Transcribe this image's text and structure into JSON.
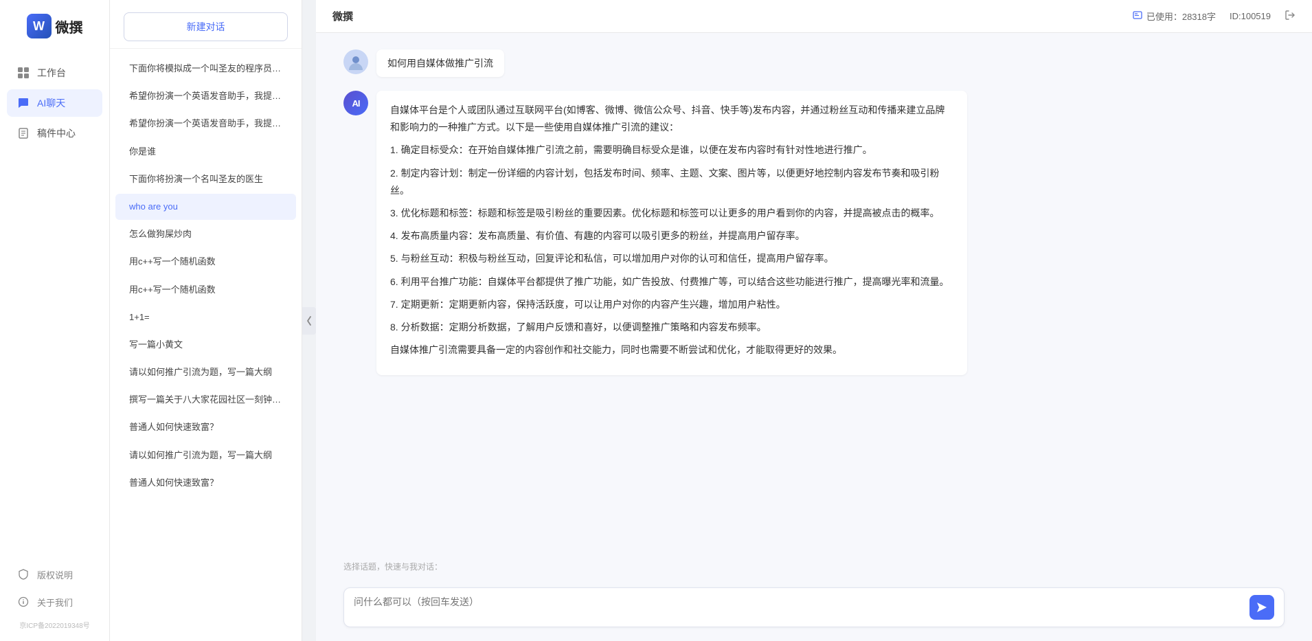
{
  "app": {
    "title": "微撰",
    "logo_letter": "W"
  },
  "topbar": {
    "title": "微撰",
    "usage_label": "已使用：28318字",
    "id_label": "ID:100519",
    "usage_icon": "info-icon"
  },
  "sidebar": {
    "nav_items": [
      {
        "id": "workbench",
        "label": "工作台",
        "icon": "grid-icon",
        "active": false
      },
      {
        "id": "ai-chat",
        "label": "AI聊天",
        "icon": "chat-icon",
        "active": true
      },
      {
        "id": "drafts",
        "label": "稿件中心",
        "icon": "file-icon",
        "active": false
      }
    ],
    "bottom_items": [
      {
        "id": "copyright",
        "label": "版权说明",
        "icon": "shield-icon"
      },
      {
        "id": "about",
        "label": "关于我们",
        "icon": "info-circle-icon"
      }
    ],
    "icp": "京ICP备2022019348号"
  },
  "history": {
    "new_chat_label": "新建对话",
    "items": [
      {
        "id": 1,
        "text": "下面你将模拟成一个叫圣友的程序员、我说...",
        "active": false
      },
      {
        "id": 2,
        "text": "希望你扮演一个英语发音助手，我提供给你...",
        "active": false
      },
      {
        "id": 3,
        "text": "希望你扮演一个英语发音助手，我提供给你...",
        "active": false
      },
      {
        "id": 4,
        "text": "你是谁",
        "active": false
      },
      {
        "id": 5,
        "text": "下面你将扮演一个名叫圣友的医生",
        "active": false
      },
      {
        "id": 6,
        "text": "who are you",
        "active": true
      },
      {
        "id": 7,
        "text": "怎么做狗屎炒肉",
        "active": false
      },
      {
        "id": 8,
        "text": "用c++写一个随机函数",
        "active": false
      },
      {
        "id": 9,
        "text": "用c++写一个随机函数",
        "active": false
      },
      {
        "id": 10,
        "text": "1+1=",
        "active": false
      },
      {
        "id": 11,
        "text": "写一篇小黄文",
        "active": false
      },
      {
        "id": 12,
        "text": "请以如何推广引流为题，写一篇大纲",
        "active": false
      },
      {
        "id": 13,
        "text": "撰写一篇关于八大家花园社区一刻钟便民生...",
        "active": false
      },
      {
        "id": 14,
        "text": "普通人如何快速致富？",
        "active": false
      },
      {
        "id": 15,
        "text": "请以如何推广引流为题，写一篇大纲",
        "active": false
      },
      {
        "id": 16,
        "text": "普通人如何快速致富？",
        "active": false
      }
    ]
  },
  "chat": {
    "user_question": "如何用自媒体做推广引流",
    "ai_response_paragraphs": [
      "自媒体平台是个人或团队通过互联网平台(如博客、微博、微信公众号、抖音、快手等)发布内容，并通过粉丝互动和传播来建立品牌和影响力的一种推广方式。以下是一些使用自媒体推广引流的建议：",
      "1. 确定目标受众：在开始自媒体推广引流之前，需要明确目标受众是谁，以便在发布内容时有针对性地进行推广。",
      "2. 制定内容计划：制定一份详细的内容计划，包括发布时间、频率、主题、文案、图片等，以便更好地控制内容发布节奏和吸引粉丝。",
      "3. 优化标题和标签：标题和标签是吸引粉丝的重要因素。优化标题和标签可以让更多的用户看到你的内容，并提高被点击的概率。",
      "4. 发布高质量内容：发布高质量、有价值、有趣的内容可以吸引更多的粉丝，并提高用户留存率。",
      "5. 与粉丝互动：积极与粉丝互动，回复评论和私信，可以增加用户对你的认可和信任，提高用户留存率。",
      "6. 利用平台推广功能：自媒体平台都提供了推广功能，如广告投放、付费推广等，可以结合这些功能进行推广，提高曝光率和流量。",
      "7. 定期更新：定期更新内容，保持活跃度，可以让用户对你的内容产生兴趣，增加用户粘性。",
      "8. 分析数据：定期分析数据，了解用户反馈和喜好，以便调整推广策略和内容发布频率。",
      "自媒体推广引流需要具备一定的内容创作和社交能力，同时也需要不断尝试和优化，才能取得更好的效果。"
    ],
    "quick_label": "选择话题，快速与我对话：",
    "input_placeholder": "问什么都可以（按回车发送）"
  }
}
